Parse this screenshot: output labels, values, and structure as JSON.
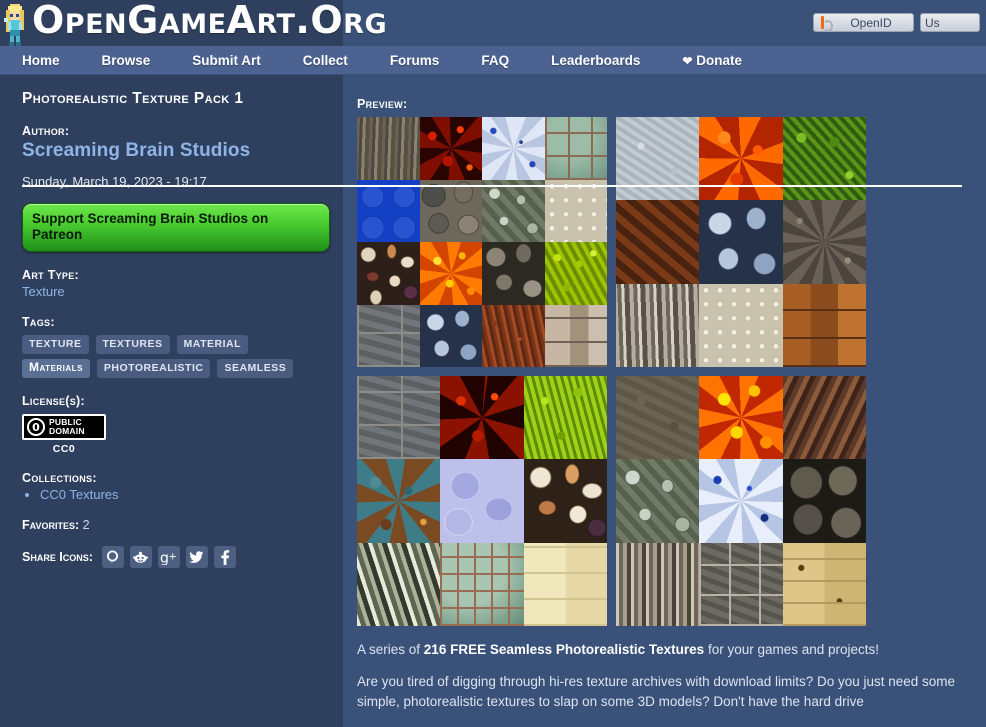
{
  "header": {
    "site_title": "OpenGameArt.Org",
    "logo_icon": "pixel-character-sprite",
    "openid": {
      "placeholder": "OpenID",
      "value": "",
      "icon": "openid-icon"
    },
    "user": {
      "placeholder": "Us",
      "value": ""
    }
  },
  "nav": {
    "items": [
      {
        "label": "Home",
        "name": "nav-home"
      },
      {
        "label": "Browse",
        "name": "nav-browse"
      },
      {
        "label": "Submit Art",
        "name": "nav-submit-art"
      },
      {
        "label": "Collect",
        "name": "nav-collect"
      },
      {
        "label": "Forums",
        "name": "nav-forums"
      },
      {
        "label": "FAQ",
        "name": "nav-faq"
      },
      {
        "label": "Leaderboards",
        "name": "nav-leaderboards"
      },
      {
        "label": "Donate",
        "name": "nav-donate",
        "icon": "heart-icon"
      }
    ]
  },
  "node": {
    "title": "Photorealistic Texture Pack 1",
    "author_label": "Author:",
    "author_name": "Screaming Brain Studios",
    "date": "Sunday, March 19, 2023 - 19:17",
    "patreon_button": "Support Screaming Brain Studios on Patreon",
    "art_type_label": "Art Type:",
    "art_type": "Texture",
    "tags_label": "Tags:",
    "tags": [
      {
        "label": "texture",
        "hover": false
      },
      {
        "label": "textures",
        "hover": false
      },
      {
        "label": "material",
        "hover": false
      },
      {
        "label": "Materials",
        "hover": true
      },
      {
        "label": "photorealistic",
        "hover": false
      },
      {
        "label": "seamless",
        "hover": false
      }
    ],
    "license_label": "License(s):",
    "license": {
      "mark": "0",
      "line1": "PUBLIC",
      "line2": "DOMAIN",
      "caption": "CC0"
    },
    "collections_label": "Collections:",
    "collections": [
      "CC0 Textures"
    ],
    "favorites_label": "Favorites:",
    "favorites_count": "2",
    "share_label": "Share Icons:",
    "share_icons": [
      {
        "name": "quote-icon",
        "glyph": "Q"
      },
      {
        "name": "reddit-icon",
        "glyph": "reddit"
      },
      {
        "name": "googleplus-icon",
        "glyph": "g+"
      },
      {
        "name": "twitter-icon",
        "glyph": "bird"
      },
      {
        "name": "facebook-icon",
        "glyph": "f"
      }
    ]
  },
  "preview": {
    "label": "Preview:",
    "images": [
      {
        "name": "preview-image-1",
        "cols": 4,
        "tiles": [
          "bark1",
          "lavared",
          "granite-blue",
          "tilegreen",
          "legoblue",
          "cobble",
          "bolts",
          "studplate",
          "pebbles",
          "lavaorange",
          "darkrock",
          "moss-lime",
          "stoneslab",
          "bluerock",
          "rust",
          "woodplank-pale"
        ]
      },
      {
        "name": "preview-image-2",
        "cols": 3,
        "tiles": [
          "concrete-lt",
          "fireorange",
          "mossgreen",
          "rustbrown",
          "bluerock",
          "gravel",
          "barkwhite",
          "studplate",
          "woodfloor"
        ]
      },
      {
        "name": "preview-image-3",
        "cols": 3,
        "tiles": [
          "stoneslab",
          "lavadark",
          "grasslime",
          "paintteal",
          "marbleblue",
          "pebbles2",
          "rockwhite",
          "mosaicgreen",
          "planklight"
        ]
      },
      {
        "name": "preview-image-4",
        "cols": 3,
        "tiles": [
          "dirtbrown",
          "firebright",
          "mulch",
          "bolts",
          "bluegravel",
          "bigrock",
          "barklight",
          "slatetile",
          "deckwood"
        ]
      }
    ]
  },
  "description": {
    "lead_prefix": "A series of ",
    "lead_bold": "216 FREE Seamless Photorealistic Textures",
    "lead_suffix": " for your games and projects!",
    "paragraph2": "Are you tired of digging through hi-res texture archives with download limits? Do you just need some simple, photorealistic textures to slap on some 3D models? Don't have the hard drive"
  },
  "colors": {
    "header_bg": "#3a5179",
    "header_dark": "#2f405e",
    "nav_bg": "#4c6291",
    "left_col_bg": "#2f405e",
    "main_bg": "#3a5179",
    "link": "#8eb4e8",
    "patreon_green": "#49cc30"
  }
}
